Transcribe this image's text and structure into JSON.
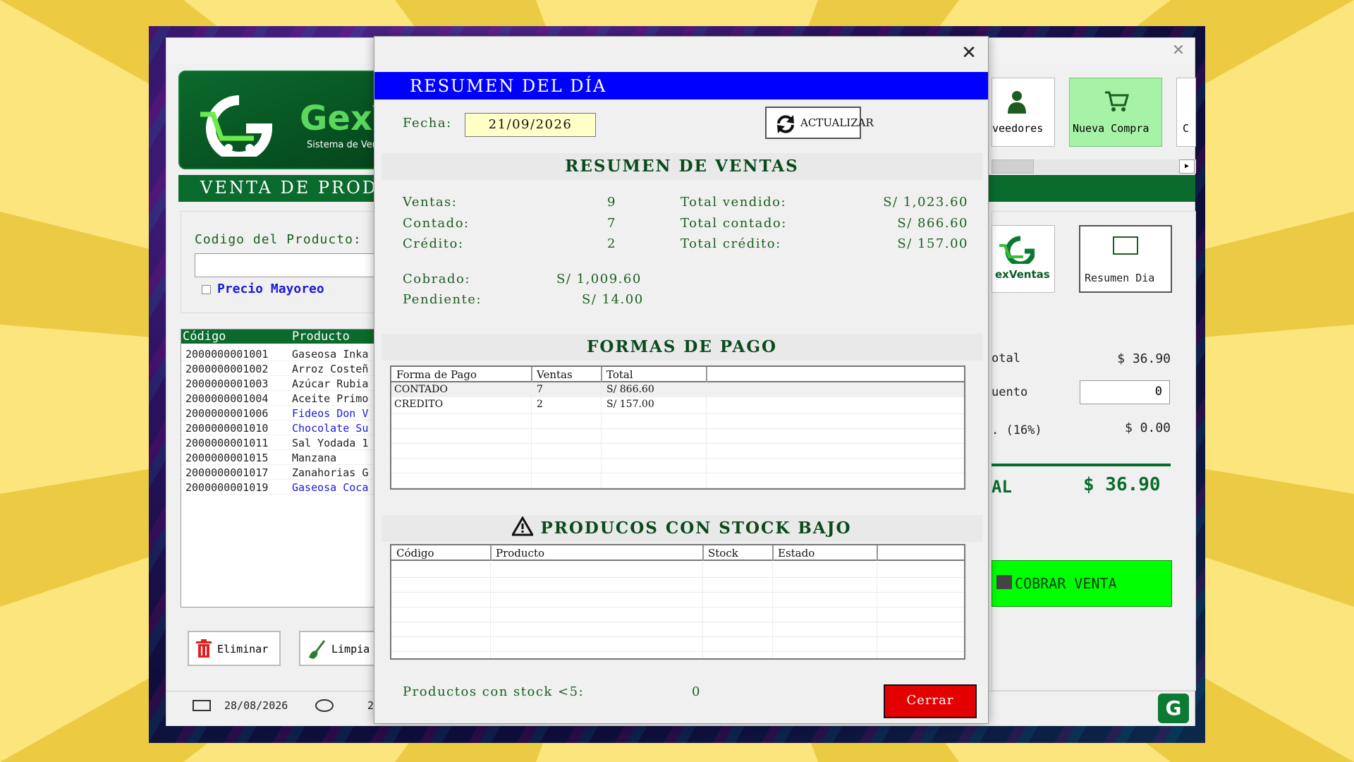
{
  "back": {
    "logo_text": "GexV",
    "logo_sub": "Sistema de Ven",
    "venta_title": "VENTA DE PRODU",
    "codigo_label": "Codigo del Producto:",
    "precio_mayoreo": "Precio Mayoreo",
    "products": {
      "headers": [
        "Código",
        "Producto"
      ],
      "rows": [
        {
          "code": "2000000001001",
          "name": "Gaseosa Inka",
          "highlight": false
        },
        {
          "code": "2000000001002",
          "name": "Arroz Costeñ",
          "highlight": false
        },
        {
          "code": "2000000001003",
          "name": "Azúcar Rubia",
          "highlight": false
        },
        {
          "code": "2000000001004",
          "name": "Aceite Primo",
          "highlight": false
        },
        {
          "code": "2000000001006",
          "name": "Fideos Don V",
          "highlight": true
        },
        {
          "code": "2000000001010",
          "name": "Chocolate Su",
          "highlight": true
        },
        {
          "code": "2000000001011",
          "name": "Sal Yodada 1",
          "highlight": false
        },
        {
          "code": "2000000001015",
          "name": "Manzana",
          "highlight": false
        },
        {
          "code": "2000000001017",
          "name": "Zanahorias G",
          "highlight": false
        },
        {
          "code": "2000000001019",
          "name": "Gaseosa Coca",
          "highlight": true
        }
      ]
    },
    "eliminar": "Eliminar",
    "limpiar": "Limpia",
    "status_date": "28/08/2026",
    "status_time": "2",
    "toolbar": {
      "proveedores": "veedores",
      "nueva_compra": "Nueva Compra",
      "more": "C"
    },
    "gexventas": "exVentas",
    "resumen_dia_btn": "Resumen Dia",
    "subtotal_label": "otal",
    "subtotal_value": "$ 36.90",
    "descuento_label": "uento",
    "descuento_value": "0",
    "iva_label": ". (16%)",
    "iva_value": "$ 0.00",
    "total_label": "AL",
    "total_value": "$ 36.90",
    "cobrar": "COBRAR VENTA"
  },
  "modal": {
    "header": "RESUMEN DEL DÍA",
    "fecha_label": "Fecha:",
    "fecha_value": "21/09/2026",
    "actualizar": "ACTUALIZAR",
    "resumen_ventas_title": "RESUMEN DE VENTAS",
    "ventas_label": "Ventas:",
    "ventas_value": "9",
    "contado_label": "Contado:",
    "contado_value": "7",
    "credito_label": "Crédito:",
    "credito_value": "2",
    "total_vendido_label": "Total vendido:",
    "total_vendido_value": "S/ 1,023.60",
    "total_contado_label": "Total contado:",
    "total_contado_value": "S/ 866.60",
    "total_credito_label": "Total crédito:",
    "total_credito_value": "S/ 157.00",
    "cobrado_label": "Cobrado:",
    "cobrado_value": "S/ 1,009.60",
    "pendiente_label": "Pendiente:",
    "pendiente_value": "S/ 14.00",
    "formas_pago_title": "FORMAS DE PAGO",
    "formas_pago": {
      "headers": [
        "Forma de Pago",
        "Ventas",
        "Total"
      ],
      "rows": [
        {
          "forma": "CONTADO",
          "ventas": "7",
          "total": "S/ 866.60"
        },
        {
          "forma": "CREDITO",
          "ventas": "2",
          "total": "S/ 157.00"
        }
      ]
    },
    "stock_title": "PRODUCOS CON STOCK BAJO",
    "stock": {
      "headers": [
        "Código",
        "Producto",
        "Stock",
        "Estado"
      ]
    },
    "stock_footer_label": "Productos con stock <5:",
    "stock_footer_value": "0",
    "cerrar": "Cerrar"
  }
}
